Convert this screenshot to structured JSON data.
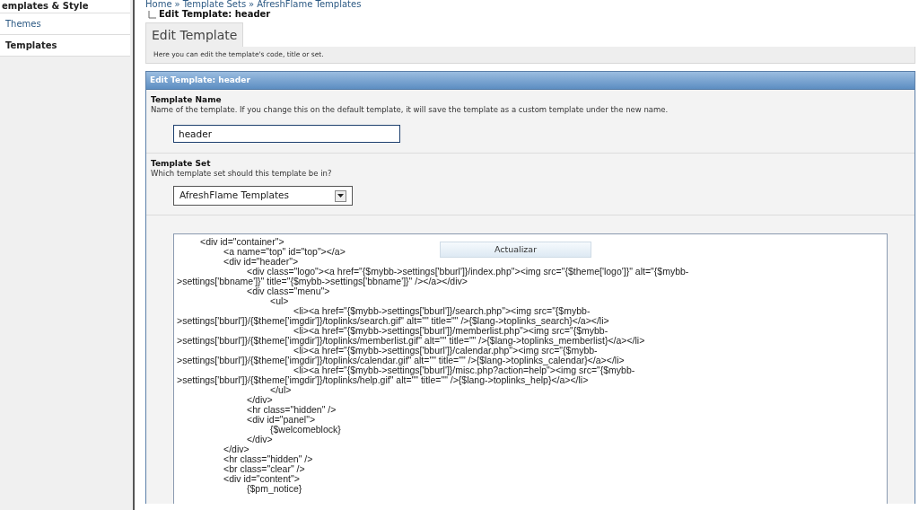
{
  "sidebar": {
    "heading": "emplates & Style",
    "items": [
      {
        "label": "Themes",
        "selected": false
      },
      {
        "label": "Templates",
        "selected": true
      }
    ]
  },
  "breadcrumb": {
    "links": [
      "Home",
      "Template Sets",
      "AfreshFlame Templates"
    ],
    "separator": "»",
    "current": "Edit Template: header"
  },
  "tab": {
    "label": "Edit Template",
    "description": "Here you can edit the template's code, title or set."
  },
  "panel": {
    "title": "Edit Template: header",
    "fields": [
      {
        "kind": "text",
        "label": "Template Name",
        "description": "Name of the template. If you change this on the default template, it will save the template as a custom template under the new name.",
        "value": "header"
      },
      {
        "kind": "select",
        "label": "Template Set",
        "description": "Which template set should this template be in?",
        "value": "AfreshFlame Templates"
      }
    ],
    "code_lines": [
      "\t<div id=\"container\">",
      "\t\t<a name=\"top\" id=\"top\"></a>",
      "\t\t<div id=\"header\">",
      "\t\t\t<div class=\"logo\"><a href=\"{$mybb->settings['bburl']}/index.php\"><img src=\"{$theme['logo']}\" alt=\"{$mybb-",
      ">settings['bbname']}\" title=\"{$mybb->settings['bbname']}\" /></a></div>",
      "\t\t\t<div class=\"menu\">",
      "\t\t\t\t<ul>",
      "\t\t\t\t\t<li><a href=\"{$mybb->settings['bburl']}/search.php\"><img src=\"{$mybb-",
      ">settings['bburl']}/{$theme['imgdir']}/toplinks/search.gif\" alt=\"\" title=\"\" />{$lang->toplinks_search}</a></li>",
      "\t\t\t\t\t<li><a href=\"{$mybb->settings['bburl']}/memberlist.php\"><img src=\"{$mybb-",
      ">settings['bburl']}/{$theme['imgdir']}/toplinks/memberlist.gif\" alt=\"\" title=\"\" />{$lang->toplinks_memberlist}</a></li>",
      "\t\t\t\t\t<li><a href=\"{$mybb->settings['bburl']}/calendar.php\"><img src=\"{$mybb-",
      ">settings['bburl']}/{$theme['imgdir']}/toplinks/calendar.gif\" alt=\"\" title=\"\" />{$lang->toplinks_calendar}</a></li>",
      "\t\t\t\t\t<li><a href=\"{$mybb->settings['bburl']}/misc.php?action=help\"><img src=\"{$mybb-",
      ">settings['bburl']}/{$theme['imgdir']}/toplinks/help.gif\" alt=\"\" title=\"\" />{$lang->toplinks_help}</a></li>",
      "\t\t\t\t</ul>",
      "\t\t\t</div>",
      "\t\t\t<hr class=\"hidden\" />",
      "\t\t\t<div id=\"panel\">",
      "\t\t\t\t{$welcomeblock}",
      "\t\t\t</div>",
      "\t\t</div>",
      "\t\t<hr class=\"hidden\" />",
      "\t\t<br class=\"clear\" />",
      "\t\t<div id=\"content\">",
      "\t\t\t{$pm_notice}"
    ],
    "floating_button": "Actualizar"
  }
}
